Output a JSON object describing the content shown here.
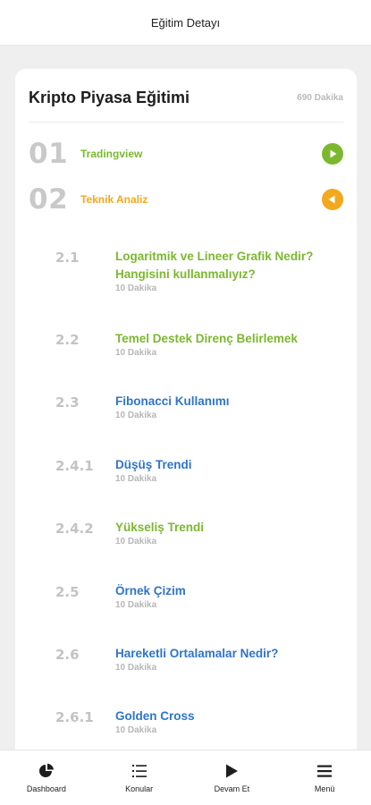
{
  "header": {
    "title": "Eğitim Detayı"
  },
  "course": {
    "title": "Kripto Piyasa Eğitimi",
    "duration": "690 Dakika"
  },
  "sections": [
    {
      "number": "01",
      "label": "Tradingview",
      "color": "#7cb82f",
      "button": "play-icon"
    },
    {
      "number": "02",
      "label": "Teknik Analiz",
      "color": "#f2a91e",
      "button": "back-icon"
    }
  ],
  "lessons": [
    {
      "number": "2.1",
      "title": "Logaritmik ve Lineer Grafik Nedir? Hangisini kullanmalıyız?",
      "duration": "10 Dakika",
      "color": "#7cb82f"
    },
    {
      "number": "2.2",
      "title": "Temel Destek Direnç Belirlemek",
      "duration": "10 Dakika",
      "color": "#7cb82f"
    },
    {
      "number": "2.3",
      "title": "Fibonacci Kullanımı",
      "duration": "10 Dakika",
      "color": "#2f74c9"
    },
    {
      "number": "2.4.1",
      "title": "Düşüş Trendi",
      "duration": "10 Dakika",
      "color": "#2f74c9"
    },
    {
      "number": "2.4.2",
      "title": "Yükseliş Trendi",
      "duration": "10 Dakika",
      "color": "#7cb82f"
    },
    {
      "number": "2.5",
      "title": "Örnek Çizim",
      "duration": "10 Dakika",
      "color": "#2f74c9"
    },
    {
      "number": "2.6",
      "title": "Hareketli Ortalamalar Nedir?",
      "duration": "10 Dakika",
      "color": "#2f74c9"
    },
    {
      "number": "2.6.1",
      "title": "Golden Cross",
      "duration": "10 Dakika",
      "color": "#2f74c9"
    }
  ],
  "tabbar": {
    "items": [
      {
        "label": "Dashboard",
        "icon": "pie-chart-icon"
      },
      {
        "label": "Konular",
        "icon": "list-icon"
      },
      {
        "label": "Devam Et",
        "icon": "play-icon"
      },
      {
        "label": "Menü",
        "icon": "menu-icon"
      }
    ]
  }
}
